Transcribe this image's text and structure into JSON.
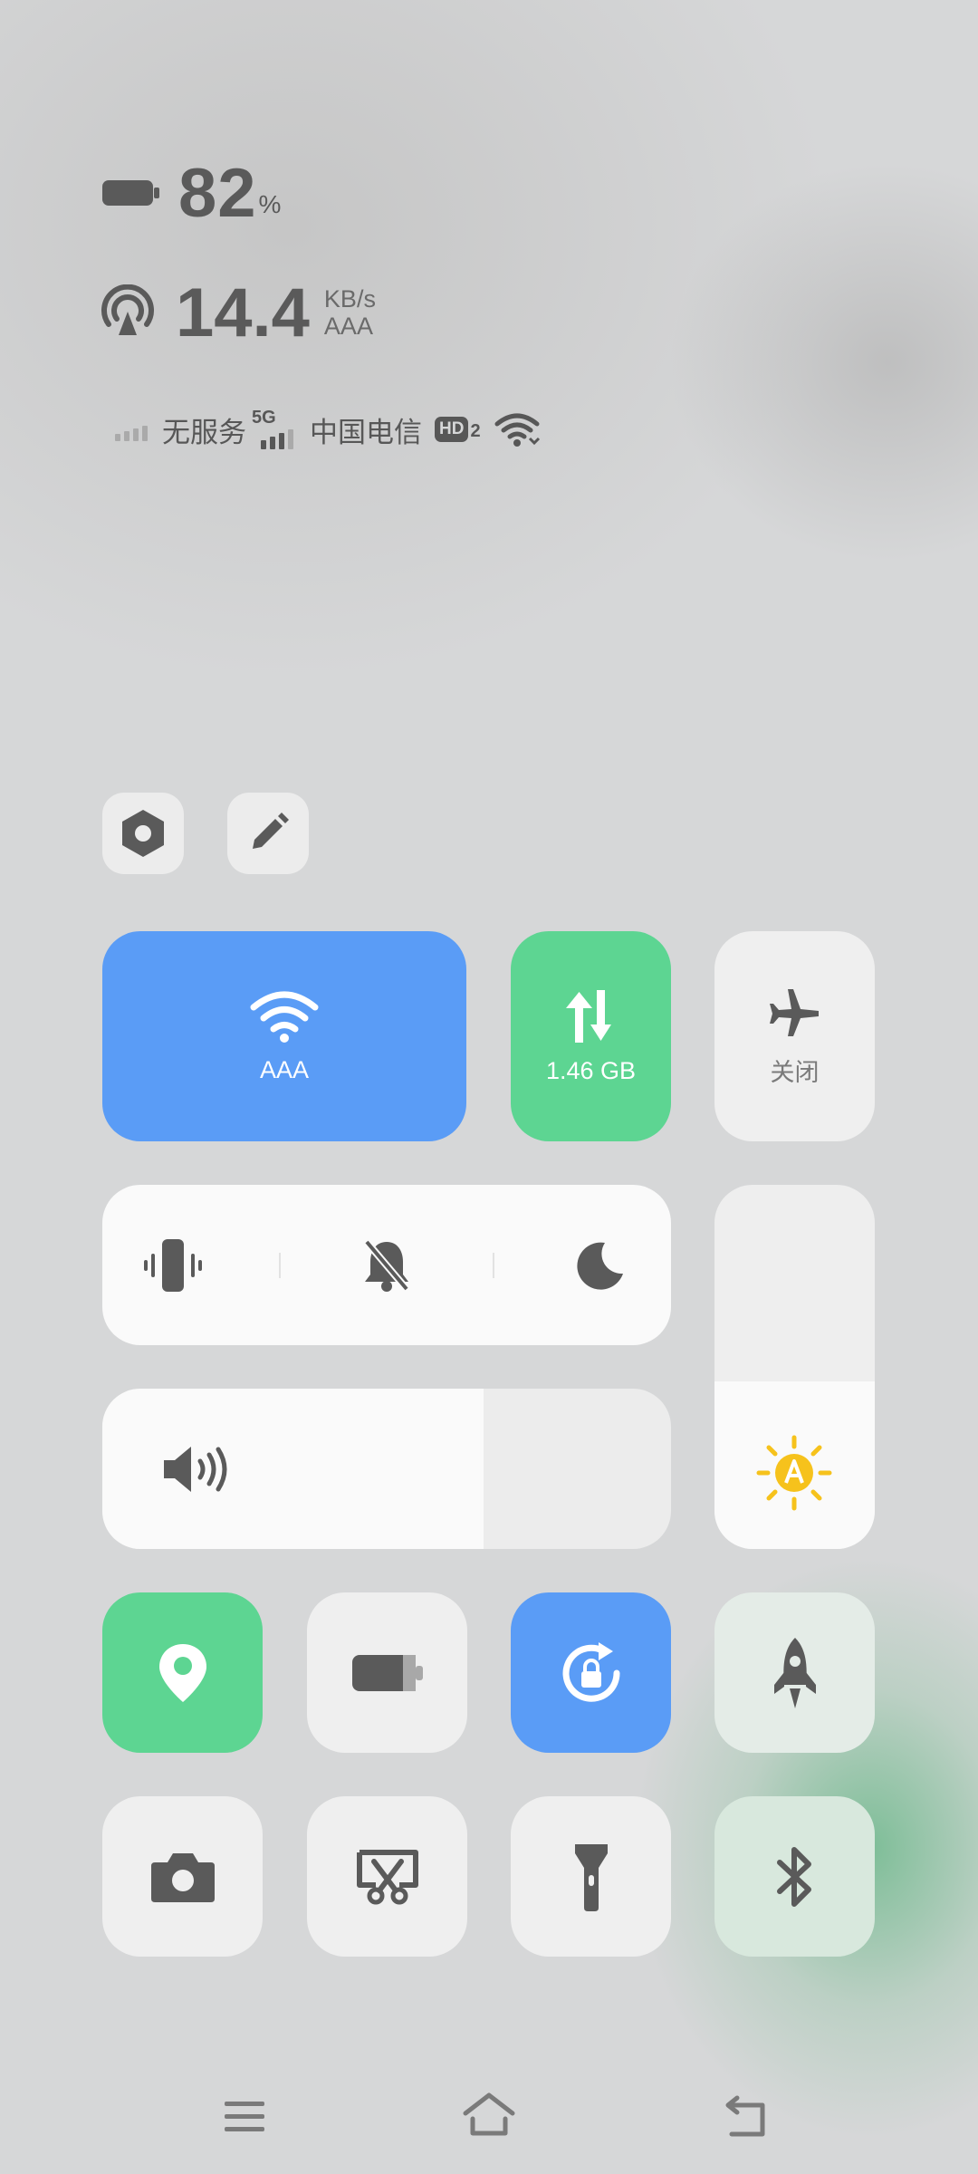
{
  "status": {
    "battery_value": "82",
    "battery_unit": "%",
    "speed_value": "14.4",
    "speed_unit": "KB/s",
    "speed_network": "AAA",
    "sim1_status": "无服务",
    "sim2_badge": "5G",
    "sim2_carrier": "中国电信",
    "hd_badge": "HD",
    "hd_sub": "2"
  },
  "tiles": {
    "wifi_label": "AAA",
    "data_label": "1.46 GB",
    "airplane_label": "关闭"
  },
  "levels": {
    "volume_fraction": 0.67,
    "brightness_fraction": 0.46
  },
  "icons": {
    "settings": "settings-hexagon-icon",
    "edit": "pencil-icon",
    "wifi": "wifi-icon",
    "mobile_data": "arrows-up-down-icon",
    "airplane": "airplane-icon",
    "vibrate": "vibrate-icon",
    "mute": "bell-off-icon",
    "dnd": "moon-icon",
    "volume": "speaker-icon",
    "brightness": "auto-brightness-sun-icon",
    "location": "location-pin-icon",
    "battery_saver": "battery-icon",
    "rotation_lock": "rotation-lock-icon",
    "game_mode": "rocket-icon",
    "camera": "camera-icon",
    "screenshot": "screenshot-scissors-icon",
    "flashlight": "flashlight-icon",
    "bluetooth": "bluetooth-icon",
    "nav_menu": "menu-icon",
    "nav_home": "home-icon",
    "nav_back": "back-icon"
  },
  "colors": {
    "blue": "#5a9cf6",
    "green": "#5dd592",
    "sun": "#f6c21c"
  }
}
